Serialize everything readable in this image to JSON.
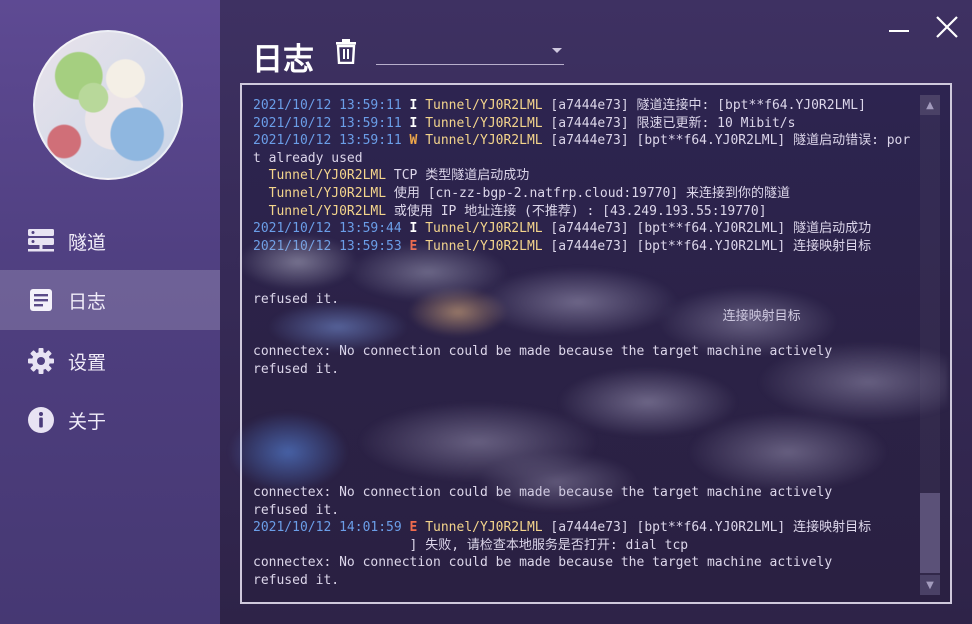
{
  "app": {
    "page_title": "日志",
    "window_controls": {
      "minimize": "minimize-icon",
      "close": "close-icon"
    }
  },
  "sidebar": {
    "items": [
      {
        "label": "隧道",
        "icon": "server-icon"
      },
      {
        "label": "日志",
        "icon": "document-icon",
        "active": true
      },
      {
        "label": "设置",
        "icon": "gear-icon"
      },
      {
        "label": "关于",
        "icon": "info-icon"
      }
    ]
  },
  "filter": {
    "selected": ""
  },
  "log": {
    "lines": [
      {
        "ts": "2021/10/12 13:59:11",
        "level": "I",
        "tunnel": "Tunnel/YJ0R2LML",
        "msg": " [a7444e73] 隧道连接中: [bpt**f64.YJ0R2LML]"
      },
      {
        "ts": "2021/10/12 13:59:11",
        "level": "I",
        "tunnel": "Tunnel/YJ0R2LML",
        "msg": " [a7444e73] 限速已更新: 10 Mibit/s"
      },
      {
        "ts": "2021/10/12 13:59:11",
        "level": "W",
        "tunnel": "Tunnel/YJ0R2LML",
        "msg": " [a7444e73] [bpt**f64.YJ0R2LML] 隧道启动错误: port already used"
      },
      {
        "ts": "",
        "level": "",
        "tunnel": "  Tunnel/YJ0R2LML",
        "msg": " TCP 类型隧道启动成功"
      },
      {
        "ts": "",
        "level": "",
        "tunnel": "  Tunnel/YJ0R2LML",
        "msg": " 使用 [cn-zz-bgp-2.natfrp.cloud:19770] 来连接到你的隧道"
      },
      {
        "ts": "",
        "level": "",
        "tunnel": "  Tunnel/YJ0R2LML",
        "msg": " 或使用 IP 地址连接 (不推荐) : [43.249.193.55:19770]"
      },
      {
        "ts": "2021/10/12 13:59:44",
        "level": "I",
        "tunnel": "Tunnel/YJ0R2LML",
        "msg": " [a7444e73] [bpt**f64.YJ0R2LML] 隧道启动成功"
      },
      {
        "ts": "2021/10/12 13:59:53",
        "level": "E",
        "tunnel": "Tunnel/YJ0R2LML",
        "msg": " [a7444e73] [bpt**f64.YJ0R2LML] 连接映射目标"
      },
      {
        "ts": "",
        "level": "",
        "tunnel": "",
        "msg": ""
      },
      {
        "ts": "",
        "level": "",
        "tunnel": "",
        "msg": ""
      },
      {
        "ts": "",
        "level": "",
        "tunnel": "",
        "msg": "refused it."
      },
      {
        "ts": "",
        "level": "",
        "tunnel": "",
        "msg": "                                                            连接映射目标"
      },
      {
        "ts": "",
        "level": "",
        "tunnel": "",
        "msg": ""
      },
      {
        "ts": "",
        "level": "",
        "tunnel": "",
        "msg": "connectex: No connection could be made because the target machine actively"
      },
      {
        "ts": "",
        "level": "",
        "tunnel": "",
        "msg": "refused it."
      },
      {
        "ts": "",
        "level": "",
        "tunnel": "",
        "msg": ""
      },
      {
        "ts": "",
        "level": "",
        "tunnel": "",
        "msg": ""
      },
      {
        "ts": "",
        "level": "",
        "tunnel": "",
        "msg": ""
      },
      {
        "ts": "",
        "level": "",
        "tunnel": "",
        "msg": ""
      },
      {
        "ts": "",
        "level": "",
        "tunnel": "",
        "msg": ""
      },
      {
        "ts": "",
        "level": "",
        "tunnel": "",
        "msg": ""
      },
      {
        "ts": "",
        "level": "",
        "tunnel": "",
        "msg": "connectex: No connection could be made because the target machine actively"
      },
      {
        "ts": "",
        "level": "",
        "tunnel": "",
        "msg": "refused it."
      },
      {
        "ts": "2021/10/12 14:01:59",
        "level": "E",
        "tunnel": "Tunnel/YJ0R2LML",
        "msg": " [a7444e73] [bpt**f64.YJ0R2LML] 连接映射目标"
      },
      {
        "ts": "",
        "level": "",
        "tunnel": "",
        "msg": "                    ] 失败, 请检查本地服务是否打开: dial tcp"
      },
      {
        "ts": "",
        "level": "",
        "tunnel": "",
        "msg": "connectex: No connection could be made because the target machine actively"
      },
      {
        "ts": "",
        "level": "",
        "tunnel": "",
        "msg": "refused it."
      }
    ]
  }
}
